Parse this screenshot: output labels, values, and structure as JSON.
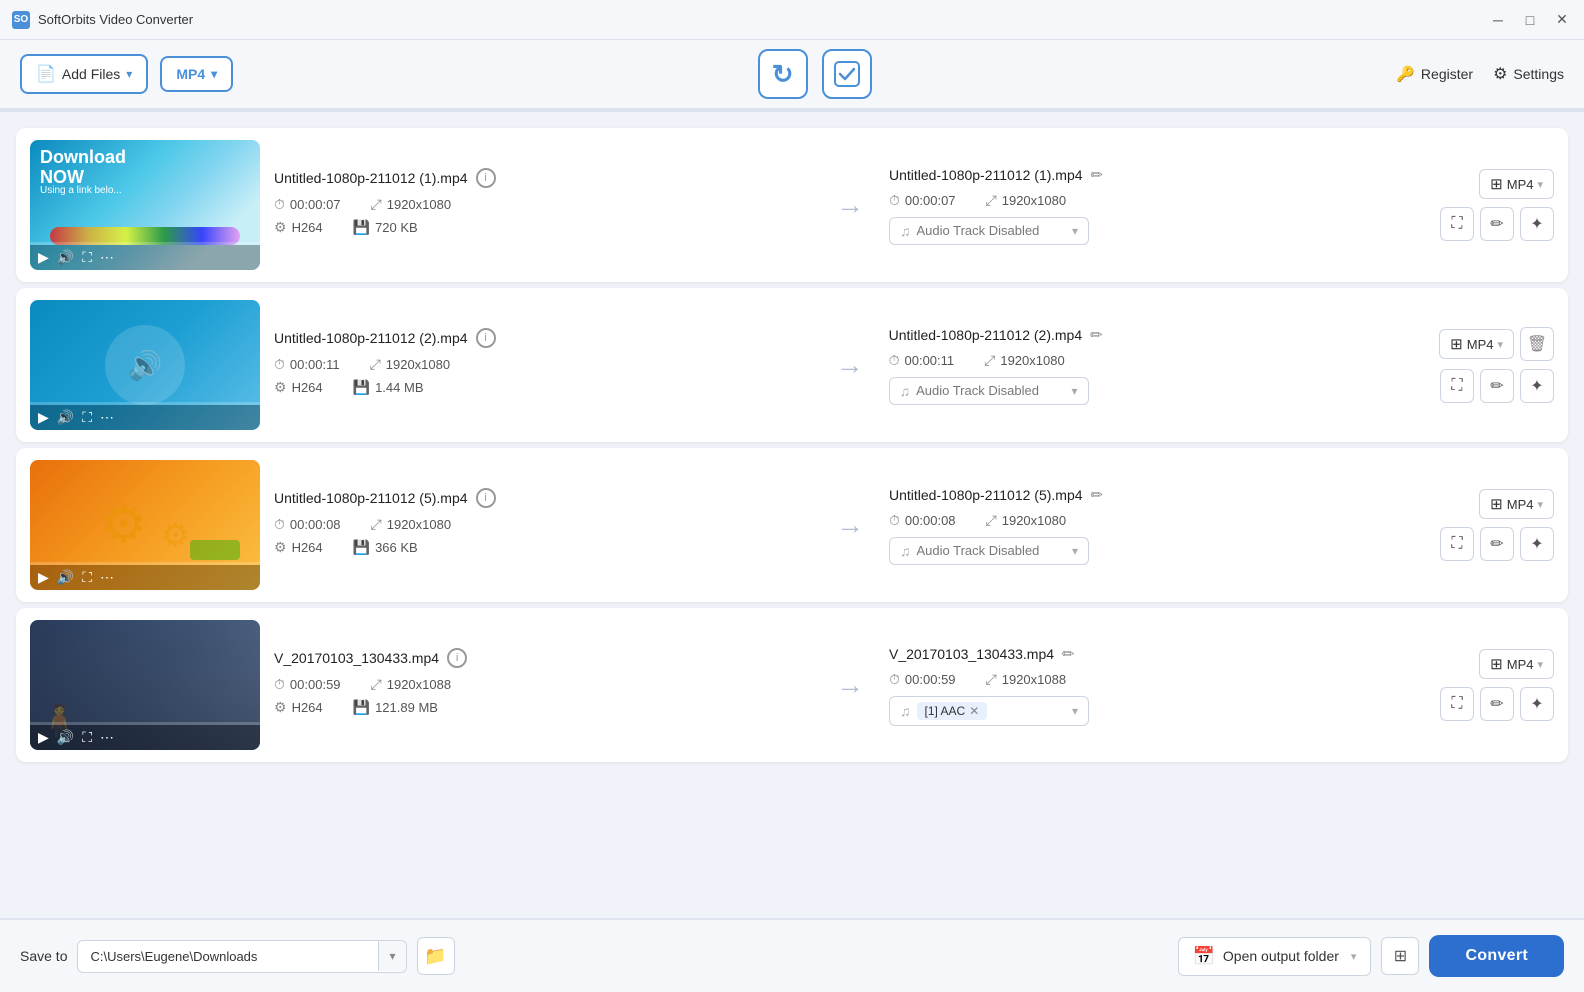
{
  "app": {
    "title": "SoftOrbits Video Converter",
    "icon": "SO"
  },
  "titlebar": {
    "minimize": "─",
    "maximize": "□",
    "close": "✕"
  },
  "toolbar": {
    "add_files_label": "Add Files",
    "format_label": "MP4",
    "register_label": "Register",
    "settings_label": "Settings"
  },
  "files": [
    {
      "id": 1,
      "input_name": "Untitled-1080p-211012 (1).mp4",
      "output_name": "Untitled-1080p-211012 (1).mp4",
      "duration": "00:00:07",
      "resolution": "1920x1080",
      "codec": "H264",
      "size": "720 KB",
      "output_format": "MP4",
      "audio": "Audio Track Disabled",
      "thumb_type": "1"
    },
    {
      "id": 2,
      "input_name": "Untitled-1080p-211012 (2).mp4",
      "output_name": "Untitled-1080p-211012 (2).mp4",
      "duration": "00:00:11",
      "resolution": "1920x1080",
      "codec": "H264",
      "size": "1.44 MB",
      "output_format": "MP4",
      "audio": "Audio Track Disabled",
      "thumb_type": "2"
    },
    {
      "id": 3,
      "input_name": "Untitled-1080p-211012 (5).mp4",
      "output_name": "Untitled-1080p-211012 (5).mp4",
      "duration": "00:00:08",
      "resolution": "1920x1080",
      "codec": "H264",
      "size": "366 KB",
      "output_format": "MP4",
      "audio": "Audio Track Disabled",
      "thumb_type": "3"
    },
    {
      "id": 4,
      "input_name": "V_20170103_130433.mp4",
      "output_name": "V_20170103_130433.mp4",
      "duration": "00:00:59",
      "resolution": "1920x1088",
      "codec": "H264",
      "size": "121.89 MB",
      "output_format": "MP4",
      "audio": "[1] AAC",
      "audio_tag": "[1] AAC",
      "thumb_type": "4"
    }
  ],
  "bottom": {
    "save_to_label": "Save to",
    "save_path": "C:\\Users\\Eugene\\Downloads",
    "open_output_label": "Open output folder",
    "convert_label": "Convert"
  },
  "icons": {
    "add": "+",
    "caret_down": "▾",
    "refresh": "↻",
    "check": "✓",
    "register": "🔑",
    "settings": "⚙",
    "arrow_right": "→",
    "info": "i",
    "clock": "⏱",
    "resize": "⤢",
    "gear": "⚙",
    "storage": "💾",
    "music": "♫",
    "edit": "✏",
    "crop": "⛶",
    "pencil": "✏",
    "wand": "✦",
    "delete": "🗑",
    "play": "▶",
    "volume": "🔊",
    "fullscreen": "⛶",
    "more": "⋯",
    "calendar": "📅",
    "grid": "⊞",
    "folder": "📁"
  }
}
